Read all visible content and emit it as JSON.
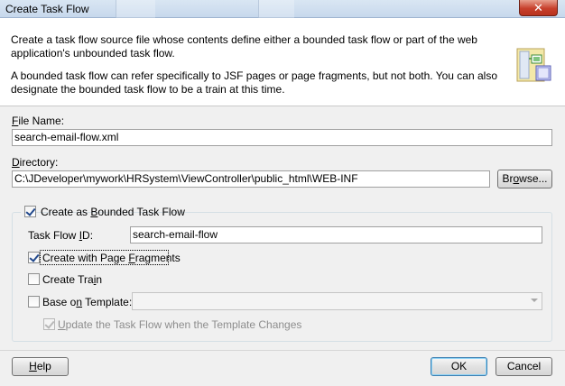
{
  "window": {
    "title": "Create Task Flow",
    "close_label": "✕"
  },
  "header": {
    "desc1": "Create a task flow source file whose contents define either a bounded task flow or part of the web application's unbounded task flow.",
    "desc2": "A bounded task flow can refer specifically to JSF pages or page fragments, but not both.  You can also designate the bounded task flow to be a train at this time.",
    "icon": "task-flow-wizard-icon"
  },
  "form": {
    "file_name_label_mnemonic": "F",
    "file_name_label_rest": "ile Name:",
    "file_name_value": "search-email-flow.xml",
    "directory_label_mnemonic": "D",
    "directory_label_rest": "irectory:",
    "directory_value": "C:\\JDeveloper\\mywork\\HRSystem\\ViewController\\public_html\\WEB-INF",
    "browse_label_pre": "Br",
    "browse_label_mnemonic": "o",
    "browse_label_post": "wse..."
  },
  "bounded": {
    "label_pre": "Create as ",
    "label_mnemonic": "B",
    "label_post": "ounded Task Flow",
    "checked": true,
    "task_flow_id_label_pre": "Task Flow ",
    "task_flow_id_label_mnemonic": "I",
    "task_flow_id_label_post": "D:",
    "task_flow_id_value": "search-email-flow",
    "fragments_label_pre": "Create with Page ",
    "fragments_label_mnemonic": "F",
    "fragments_label_post": "ragments",
    "fragments_checked": true,
    "train_label_pre": "Create Tra",
    "train_label_mnemonic": "i",
    "train_label_post": "n",
    "train_checked": false,
    "template_label_pre": "Base o",
    "template_label_mnemonic": "n",
    "template_label_post": " Template:",
    "template_checked": false,
    "template_value": "",
    "update_label_pre": "",
    "update_label_mnemonic": "U",
    "update_label_post": "pdate the Task Flow when the Template Changes",
    "update_checked": true
  },
  "footer": {
    "help_mnemonic": "H",
    "help_rest": "elp",
    "ok_label": "OK",
    "cancel_label": "Cancel"
  }
}
